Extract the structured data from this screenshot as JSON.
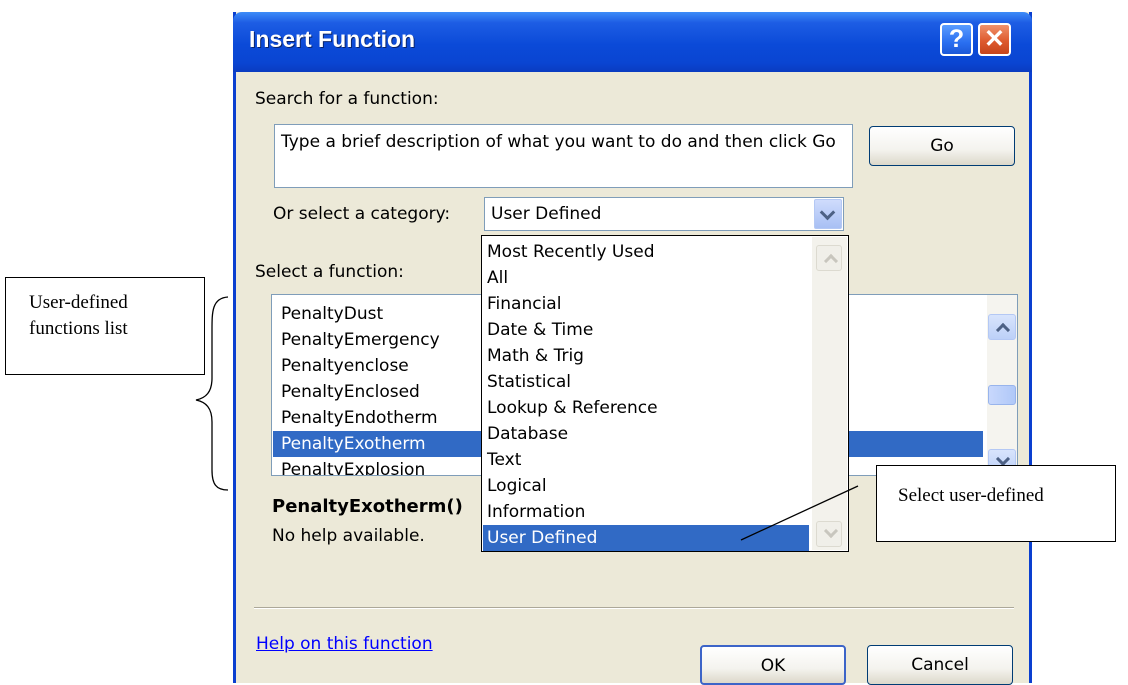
{
  "dialog": {
    "title": "Insert Function",
    "help_btn": "?",
    "close_btn": "✕",
    "search_label": "Search for a function:",
    "search_placeholder": "Type a brief description of what you want to do and then click Go",
    "go_button": "Go",
    "category_label": "Or select a category:",
    "category_value": "User Defined",
    "function_label": "Select a function:",
    "functions": [
      "PenaltyDust",
      "PenaltyEmergency",
      "Penaltyenclose",
      "PenaltyEnclosed",
      "PenaltyEndotherm",
      "PenaltyExotherm",
      "PenaltyExplosion"
    ],
    "selected_function": "PenaltyExotherm",
    "signature": "PenaltyExotherm()",
    "description": "No help available.",
    "help_link": "Help on this function",
    "ok_button": "OK",
    "cancel_button": "Cancel"
  },
  "dropdown": {
    "options": [
      "Most Recently Used",
      "All",
      "Financial",
      "Date & Time",
      "Math & Trig",
      "Statistical",
      "Lookup & Reference",
      "Database",
      "Text",
      "Logical",
      "Information",
      "User Defined"
    ],
    "selected": "User Defined"
  },
  "annotations": {
    "left_line1": "User-defined",
    "left_line2": "functions list",
    "right": "Select user-defined"
  },
  "colors": {
    "titlebar": "#0a4ad8",
    "selection": "#316ac5",
    "dialog_bg": "#ece9d8",
    "link": "#0000ff"
  }
}
